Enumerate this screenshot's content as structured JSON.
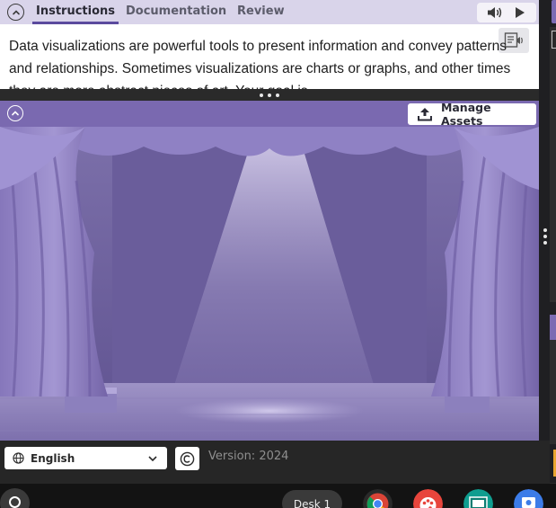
{
  "instructions": {
    "tabs": [
      {
        "label": "Instructions",
        "active": true
      },
      {
        "label": "Documentation",
        "active": false
      },
      {
        "label": "Review",
        "active": false
      }
    ],
    "text": "Data visualizations are powerful tools to present information and convey patterns and relationships. Sometimes visualizations are charts or graphs, and other times they are more abstract pieces of art. Your goal is"
  },
  "stage": {
    "manage_assets_label": "Manage Assets",
    "background": "theater-stage-purple"
  },
  "footer": {
    "language": "English",
    "version": "Version: 2024"
  },
  "taskbar": {
    "desk_label": "Desk 1",
    "apps": [
      "chrome-icon",
      "paint-icon",
      "classroom-icon",
      "screencast-icon"
    ]
  },
  "colors": {
    "accent": "#7a69b0",
    "tabbar": "#d9d4ea",
    "stage": "#6d5f9c"
  }
}
